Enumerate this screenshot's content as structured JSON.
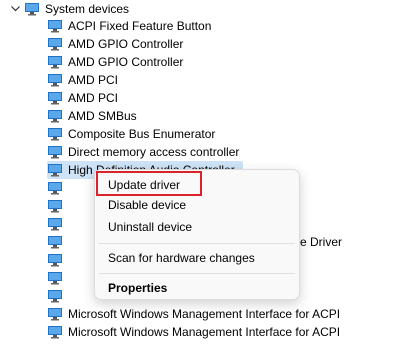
{
  "tree": {
    "category": {
      "label": "System devices",
      "icon": "computer-monitor-icon",
      "expanded": true
    },
    "devices": [
      "ACPI Fixed Feature Button",
      "AMD GPIO Controller",
      "AMD GPIO Controller",
      "AMD PCI",
      "AMD PCI",
      "AMD SMBus",
      "Composite Bus Enumerator",
      "Direct memory access controller",
      "High Definition Audio Controller"
    ],
    "hidden_rows_visible_fragment": "e Driver",
    "bottom_devices": [
      "Microsoft Windows Management Interface for ACPI",
      "Microsoft Windows Management Interface for ACPI"
    ],
    "device_icon": "monitor-icon"
  },
  "context_menu": {
    "items": [
      {
        "label": "Update driver",
        "highlighted": true
      },
      {
        "label": "Disable device"
      },
      {
        "label": "Uninstall device"
      },
      {
        "label": "Scan for hardware changes"
      },
      {
        "label": "Properties",
        "bold": true
      }
    ]
  },
  "colors": {
    "selection": "#cfe3f7",
    "annotation_red": "#d8242b",
    "menu_bg": "#f9f9f9",
    "icon_blue": "#1e73c8"
  }
}
